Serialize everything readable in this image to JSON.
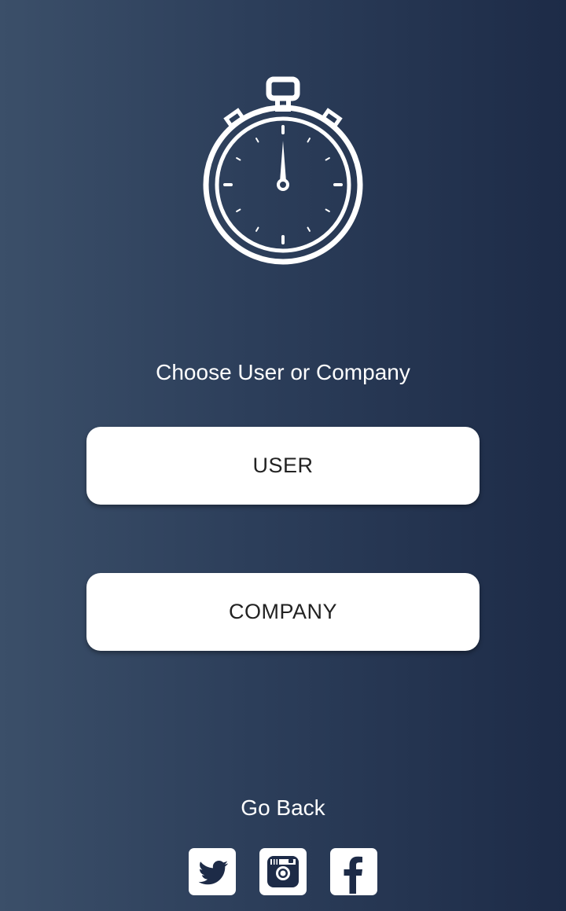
{
  "prompt": "Choose User or Company",
  "buttons": {
    "user_label": "USER",
    "company_label": "COMPANY"
  },
  "go_back_label": "Go Back",
  "social": [
    {
      "icon": "twitter-icon"
    },
    {
      "icon": "instagram-icon"
    },
    {
      "icon": "facebook-icon"
    }
  ],
  "logo_icon": "stopwatch-icon",
  "colors": {
    "background_left": "#3b4f69",
    "background_right": "#1d2b47",
    "button_bg": "#ffffff",
    "button_text": "#222222",
    "icon_color": "#1d2b47"
  }
}
